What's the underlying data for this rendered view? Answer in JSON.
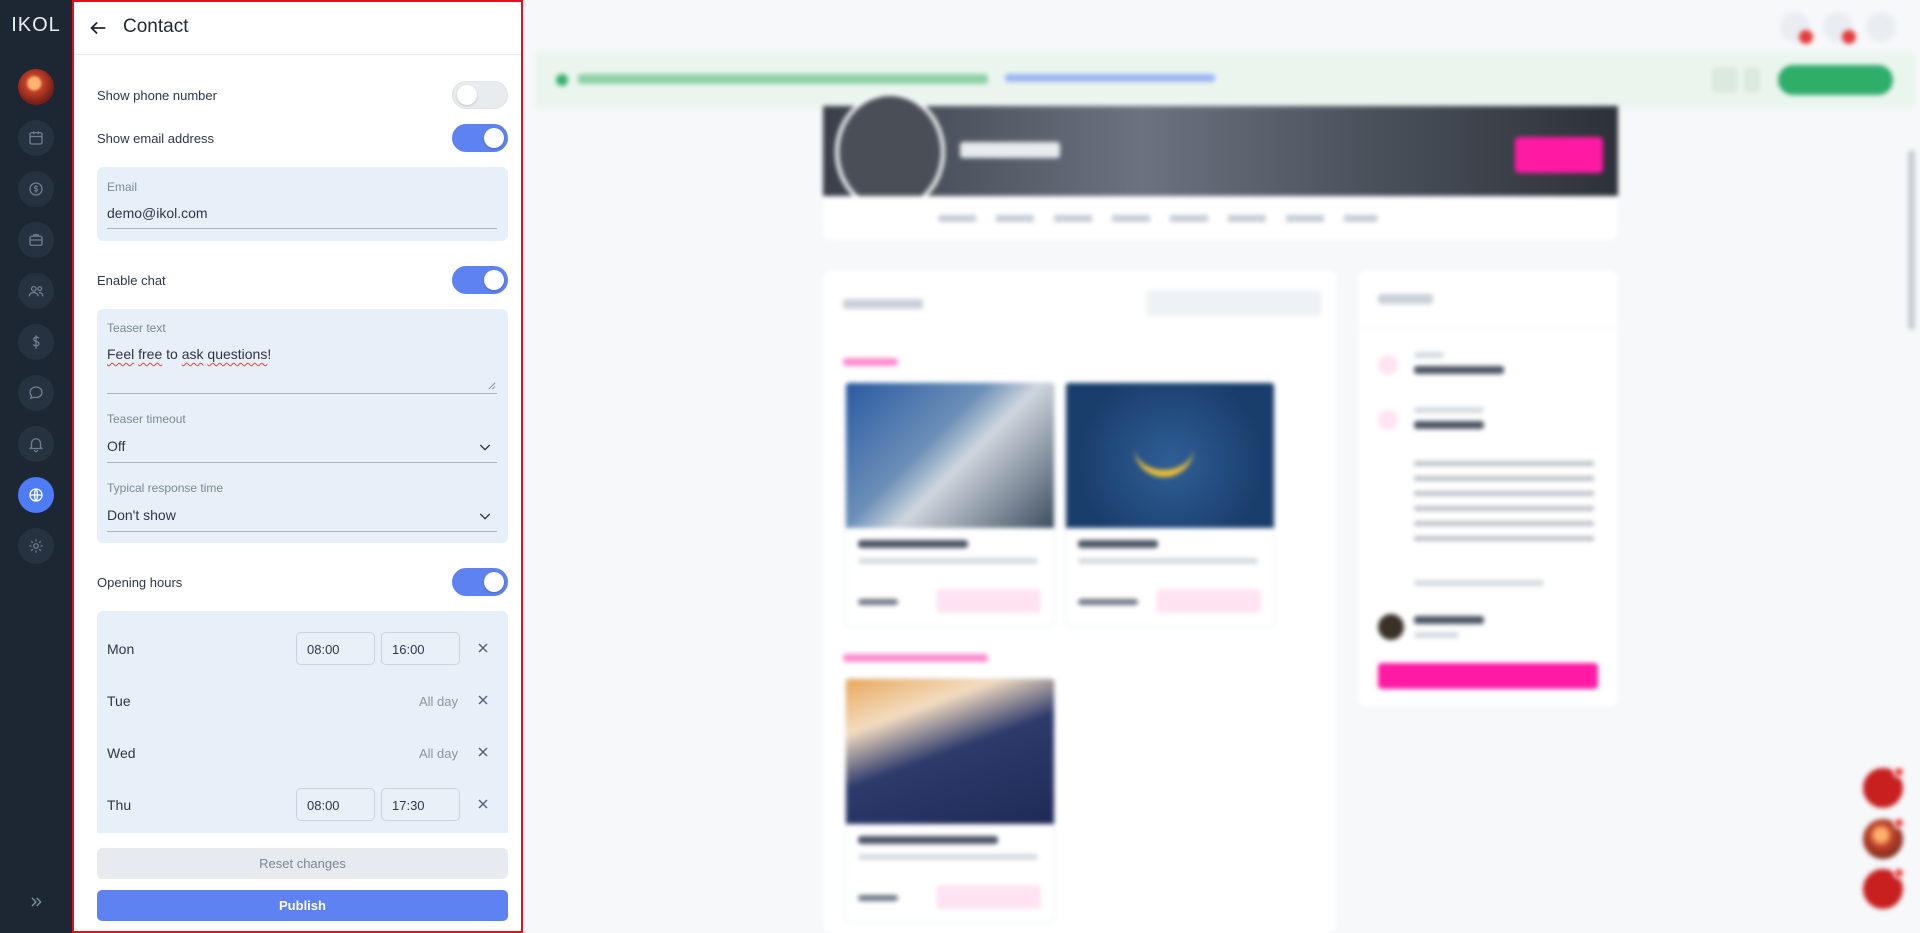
{
  "app": {
    "logo": "IKOL"
  },
  "sidebar": {
    "items": [
      {
        "name": "calendar-icon"
      },
      {
        "name": "dollar-chat-icon"
      },
      {
        "name": "briefcase-icon"
      },
      {
        "name": "users-icon"
      },
      {
        "name": "dollar-icon"
      },
      {
        "name": "chat-icon"
      },
      {
        "name": "bell-icon"
      },
      {
        "name": "globe-icon",
        "active": true
      },
      {
        "name": "gear-icon"
      }
    ],
    "expand_icon": "double-chevron-right-icon"
  },
  "panel": {
    "title": "Contact",
    "show_phone": {
      "label": "Show phone number",
      "on": false
    },
    "show_email": {
      "label": "Show email address",
      "on": true
    },
    "email": {
      "label": "Email",
      "value": "demo@ikol.com"
    },
    "enable_chat": {
      "label": "Enable chat",
      "on": true
    },
    "teaser_text": {
      "label": "Teaser text",
      "value_parts": [
        "Feel",
        " ",
        "free",
        " to ",
        "ask",
        " ",
        "questions",
        "!"
      ]
    },
    "teaser_timeout": {
      "label": "Teaser timeout",
      "value": "Off"
    },
    "response_time": {
      "label": "Typical response time",
      "value": "Don't show"
    },
    "opening_hours": {
      "label": "Opening hours",
      "on": true,
      "days": [
        {
          "day": "Mon",
          "from": "08:00",
          "to": "16:00"
        },
        {
          "day": "Tue",
          "all_day": "All day"
        },
        {
          "day": "Wed",
          "all_day": "All day"
        },
        {
          "day": "Thu",
          "from": "08:00",
          "to": "17:30"
        }
      ]
    },
    "reset_label": "Reset changes",
    "publish_label": "Publish"
  },
  "colors": {
    "accent": "#5f82f2",
    "rail": "#1c2733",
    "highlight_border": "#e1111b",
    "brand_pink": "#ff1aa3",
    "success": "#2fae6a"
  }
}
